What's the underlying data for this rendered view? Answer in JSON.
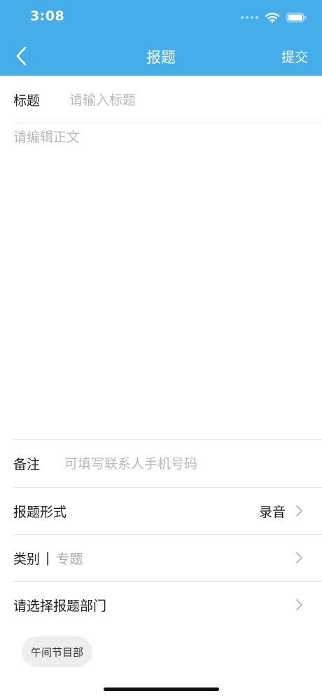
{
  "status_bar": {
    "time": "3:08"
  },
  "nav": {
    "title": "报题",
    "submit_label": "提交"
  },
  "form": {
    "title_label": "标题",
    "title_placeholder": "请输入标题",
    "body_placeholder": "请编辑正文",
    "remark_label": "备注",
    "remark_placeholder": "可填写联系人手机号码",
    "report_form_label": "报题形式",
    "report_form_value": "录音",
    "category_label": "类别",
    "category_separator": "|",
    "category_value": "专题",
    "department_label": "请选择报题部门",
    "department_tag": "午间节目部"
  },
  "colors": {
    "header_bg": "#45ADEA",
    "placeholder": "#b9b9b9",
    "tag_bg": "#eeeeee"
  },
  "icons": [
    "wifi-icon",
    "battery-icon",
    "back-chevron-icon",
    "chevron-right-icon"
  ]
}
